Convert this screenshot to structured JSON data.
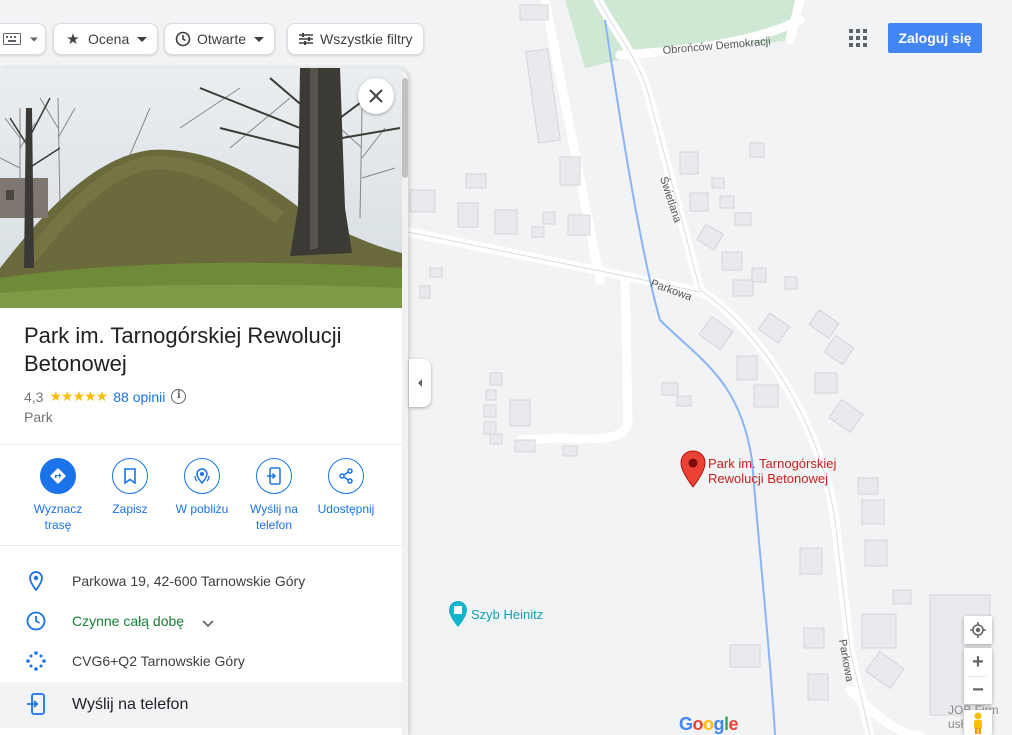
{
  "toolbar": {
    "filter_rating": "Ocena",
    "filter_open": "Otwarte",
    "filter_all": "Wszystkie filtry"
  },
  "header": {
    "login_label": "Zaloguj się"
  },
  "place": {
    "title": "Park im. Tarnogórskiej Rewolucji Betonowej",
    "rating": "4,3",
    "stars": "★★★★★",
    "reviews": "88 opinii",
    "category": "Park"
  },
  "actions": [
    {
      "label": "Wyznacz trasę",
      "icon": "directions-icon"
    },
    {
      "label": "Zapisz",
      "icon": "bookmark-icon"
    },
    {
      "label": "W pobliżu",
      "icon": "nearby-icon"
    },
    {
      "label": "Wyślij na telefon",
      "icon": "send-to-phone-icon"
    },
    {
      "label": "Udostępnij",
      "icon": "share-icon"
    }
  ],
  "details": {
    "address": "Parkowa 19, 42-600 Tarnowskie Góry",
    "hours": "Czynne całą dobę",
    "plus_code": "CVG6+Q2 Tarnowskie Góry",
    "send_to_phone": "Wyślij na telefon"
  },
  "map": {
    "marker_label": "Park im. Tarnogórskiej Rewolucji Betonowej",
    "poi_label": "Szyb Heinitz",
    "streets": [
      "Obrońców Demokracji",
      "Świetlana",
      "Parkowa",
      "Parkowa"
    ],
    "corner_label": "JOB Firm usł",
    "logo": "Google"
  },
  "colors": {
    "accent": "#1a73e8",
    "marker": "#ea4335",
    "poi": "#12b5cb",
    "open_status": "#188038",
    "star": "#fbbc04"
  }
}
